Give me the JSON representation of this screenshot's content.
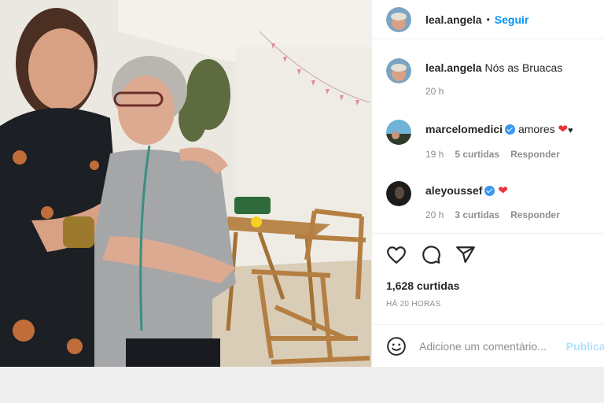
{
  "post": {
    "author": "leal.angela",
    "follow_label": "Seguir",
    "separator": "•"
  },
  "caption": {
    "user": "leal.angela",
    "text": "Nós as Bruacas",
    "time": "20 h"
  },
  "comments": [
    {
      "user": "marcelomedici",
      "verified": true,
      "text": "amores",
      "time": "19 h",
      "likes": "5 curtidas",
      "reply_label": "Responder"
    },
    {
      "user": "aleyoussef",
      "verified": true,
      "text": "",
      "time": "20 h",
      "likes": "3 curtidas",
      "reply_label": "Responder"
    }
  ],
  "stats": {
    "likes": "1,628 curtidas",
    "ago": "HÁ 20 HORAS"
  },
  "add_comment": {
    "placeholder": "Adicione um comentário...",
    "post_label": "Publicar"
  },
  "colors": {
    "accent": "#0095f6",
    "heart": "#e8333a",
    "muted": "#8e8e8e",
    "verified": "#3897f0"
  },
  "icons": [
    "heart-icon",
    "comment-icon",
    "share-icon",
    "emoji-icon",
    "verified-badge-icon"
  ]
}
